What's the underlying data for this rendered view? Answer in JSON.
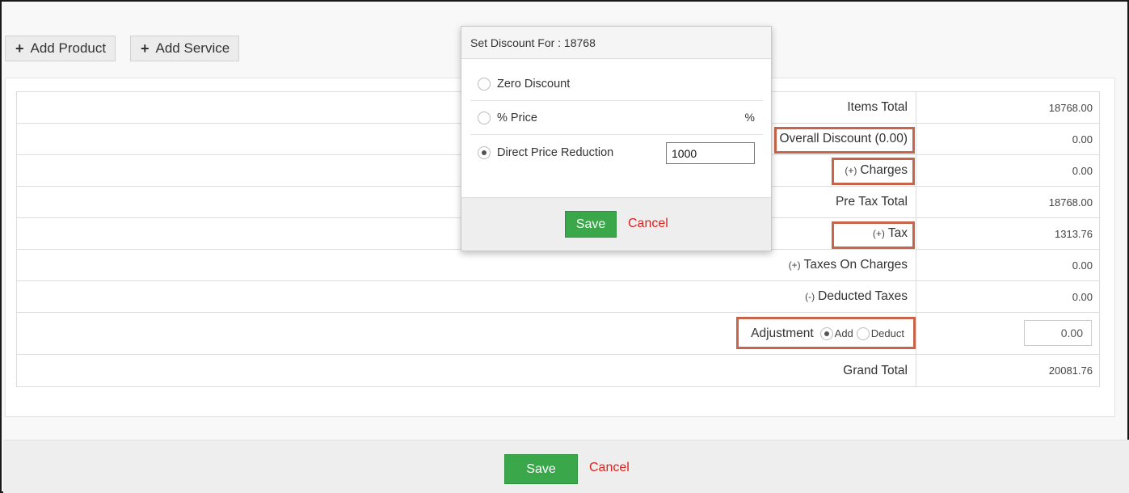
{
  "toolbar": {
    "add_product_label": "Add Product",
    "add_service_label": "Add Service",
    "plus_glyph": "+"
  },
  "totals": {
    "rows": [
      {
        "prefix": "",
        "label": "Items Total",
        "value": "18768.00"
      },
      {
        "prefix": "",
        "label": "Overall Discount (0.00)",
        "value": "0.00"
      },
      {
        "prefix": "(+)",
        "label": "Charges",
        "value": "0.00"
      },
      {
        "prefix": "",
        "label": "Pre Tax Total",
        "value": "18768.00"
      },
      {
        "prefix": "(+)",
        "label": "Tax",
        "value": "1313.76"
      },
      {
        "prefix": "(+)",
        "label": "Taxes On Charges",
        "value": "0.00"
      },
      {
        "prefix": "(-)",
        "label": "Deducted Taxes",
        "value": "0.00"
      }
    ],
    "adjustment": {
      "label": "Adjustment",
      "option_add": "Add",
      "option_deduct": "Deduct",
      "selected": "Add",
      "value": "0.00"
    },
    "grand_total": {
      "label": "Grand Total",
      "value": "20081.76"
    }
  },
  "footer": {
    "save_label": "Save",
    "cancel_label": "Cancel"
  },
  "discount_modal": {
    "title": "Set Discount For : 18768",
    "options": {
      "zero": "Zero Discount",
      "percent": "% Price",
      "percent_suffix": "%",
      "direct": "Direct Price Reduction"
    },
    "selected": "Direct Price Reduction",
    "direct_value": "1000",
    "save_label": "Save",
    "cancel_label": "Cancel"
  },
  "colors": {
    "save_green": "#3aa84a",
    "cancel_red": "#e0201c",
    "highlight": "#c8644a"
  }
}
